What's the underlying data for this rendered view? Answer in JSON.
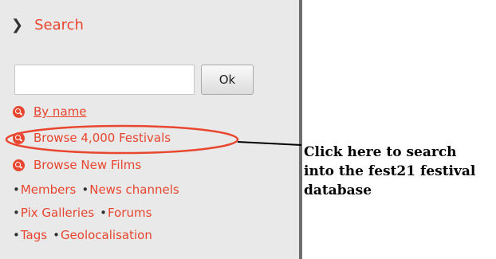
{
  "sidebar": {
    "section_title": "Search",
    "search_input": {
      "value": "",
      "placeholder": ""
    },
    "ok_label": "Ok",
    "search_links": [
      {
        "label": "By name"
      },
      {
        "label": "Browse 4,000 Festivals"
      },
      {
        "label": "Browse New Films"
      }
    ],
    "nav_rows": [
      [
        "Members",
        "News channels"
      ],
      [
        "Pix Galleries",
        "Forums"
      ],
      [
        "Tags",
        "Geolocalisation"
      ]
    ],
    "bullet": "•"
  },
  "annotation": {
    "lines": [
      "Click here to search",
      "into the fest21 festival",
      "database"
    ],
    "highlight_color": "#e8462f"
  },
  "colors": {
    "accent": "#e8462f",
    "sidebar_bg": "#e9e9e9",
    "divider": "#6e6e6e"
  }
}
